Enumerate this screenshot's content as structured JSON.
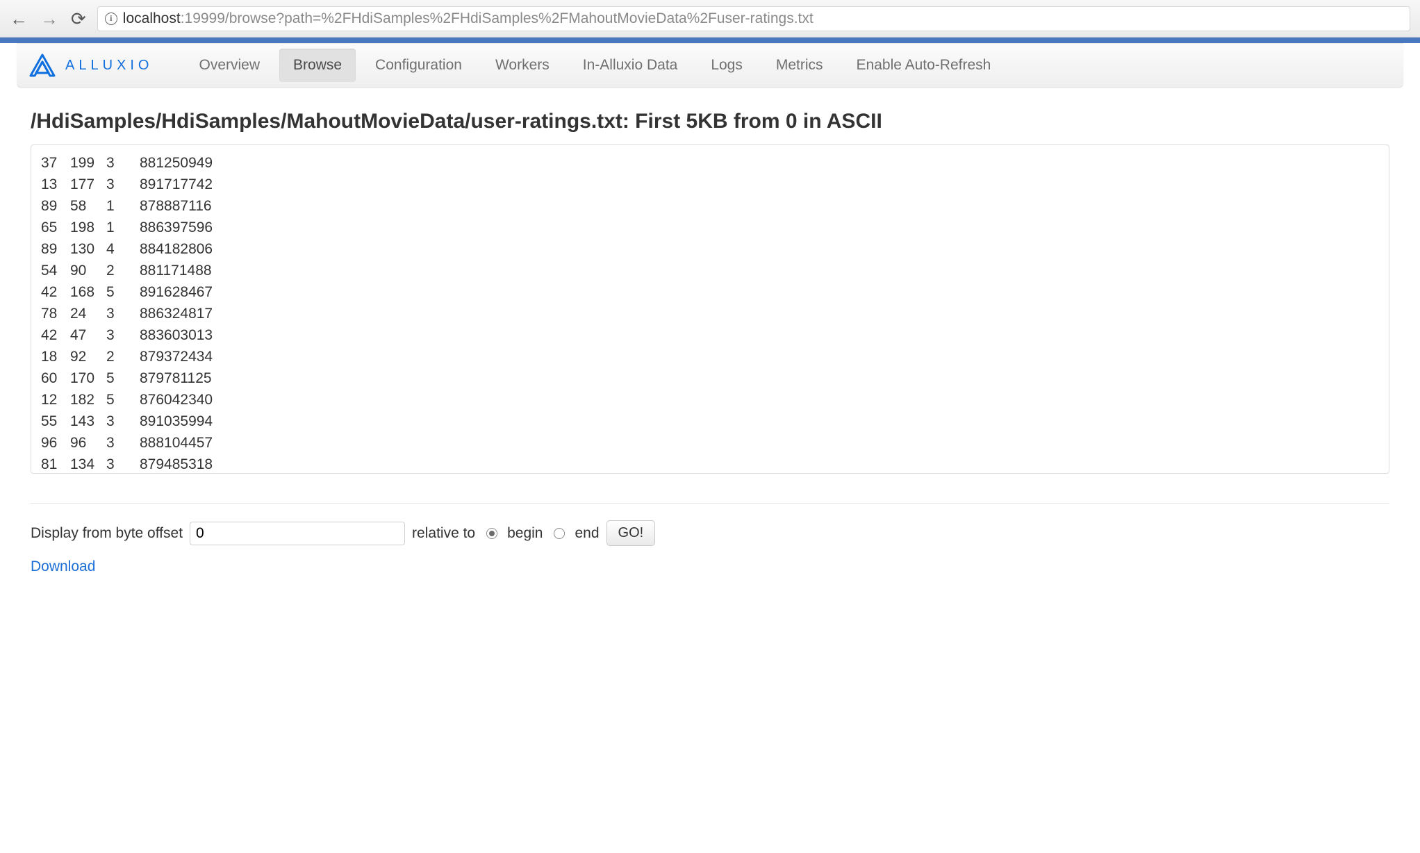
{
  "browser": {
    "url_host": "localhost",
    "url_rest": ":19999/browse?path=%2FHdiSamples%2FHdiSamples%2FMahoutMovieData%2Fuser-ratings.txt"
  },
  "brand": {
    "name": "ALLUXIO"
  },
  "nav": {
    "items": [
      {
        "label": "Overview",
        "active": false
      },
      {
        "label": "Browse",
        "active": true
      },
      {
        "label": "Configuration",
        "active": false
      },
      {
        "label": "Workers",
        "active": false
      },
      {
        "label": "In-Alluxio Data",
        "active": false
      },
      {
        "label": "Logs",
        "active": false
      },
      {
        "label": "Metrics",
        "active": false
      },
      {
        "label": "Enable Auto-Refresh",
        "active": false
      }
    ]
  },
  "page": {
    "title": "/HdiSamples/HdiSamples/MahoutMovieData/user-ratings.txt: First 5KB from 0 in ASCII"
  },
  "file_rows": [
    [
      "37",
      "199",
      "3",
      "881250949"
    ],
    [
      "13",
      "177",
      "3",
      "891717742"
    ],
    [
      "89",
      "58",
      "1",
      "878887116"
    ],
    [
      "65",
      "198",
      "1",
      "886397596"
    ],
    [
      "89",
      "130",
      "4",
      "884182806"
    ],
    [
      "54",
      "90",
      "2",
      "881171488"
    ],
    [
      "42",
      "168",
      "5",
      "891628467"
    ],
    [
      "78",
      "24",
      "3",
      "886324817"
    ],
    [
      "42",
      "47",
      "3",
      "883603013"
    ],
    [
      "18",
      "92",
      "2",
      "879372434"
    ],
    [
      "60",
      "170",
      "5",
      "879781125"
    ],
    [
      "12",
      "182",
      "5",
      "876042340"
    ],
    [
      "55",
      "143",
      "3",
      "891035994"
    ],
    [
      "96",
      "96",
      "3",
      "888104457"
    ],
    [
      "81",
      "134",
      "3",
      "879485318"
    ]
  ],
  "offset_form": {
    "label_prefix": "Display from byte offset",
    "value": "0",
    "relative_label": "relative to",
    "begin_label": "begin",
    "end_label": "end",
    "selected": "begin",
    "go_label": "GO!"
  },
  "download_label": "Download"
}
